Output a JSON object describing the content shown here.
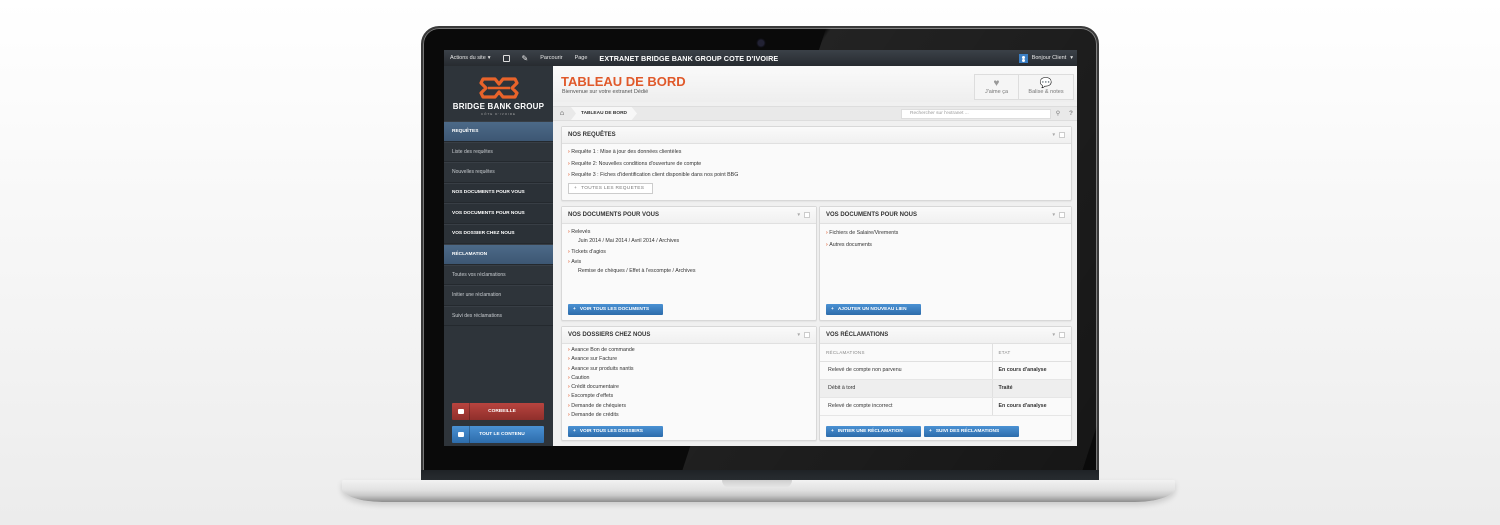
{
  "topbar": {
    "site_actions": "Actions du site",
    "browse": "Parcourir",
    "page": "Page",
    "title": "EXTRANET BRIDGE BANK GROUP COTE D'IVOIRE",
    "user": "Bonjour Client"
  },
  "logo": {
    "name": "BRIDGE BANK GROUP",
    "sub": "CÔTE D'IVOIRE",
    "brand_color": "#e8632a"
  },
  "sidebar": {
    "items": [
      {
        "label": "REQUÊTES",
        "type": "header"
      },
      {
        "label": "Liste des requêtes",
        "type": "sub"
      },
      {
        "label": "Nouvelles requêtes",
        "type": "sub"
      },
      {
        "label": "NOS DOCUMENTS POUR VOUS",
        "type": "section"
      },
      {
        "label": "VOS DOCUMENTS POUR NOUS",
        "type": "section"
      },
      {
        "label": "VOS DOSSIER CHEZ NOUS",
        "type": "section"
      },
      {
        "label": "RÉCLAMATION",
        "type": "header"
      },
      {
        "label": "Toutes vos réclamations",
        "type": "sub"
      },
      {
        "label": "Initier une réclamation",
        "type": "sub"
      },
      {
        "label": "Suivi des réclamations",
        "type": "sub"
      }
    ],
    "trash_button": "CORBEILLE",
    "all_content_button": "TOUT LE CONTENU"
  },
  "header": {
    "title": "TABLEAU DE BORD",
    "subtitle": "Bienvenue sur votre extranet Dédié",
    "like": "J'aime ça",
    "tags": "Balise & notes"
  },
  "breadcrumb": {
    "current": "TABLEAU DE BORD"
  },
  "search": {
    "placeholder": "Rechercher sur l'extranet ..."
  },
  "panels": {
    "requetes": {
      "title": "NOS REQUÊTES",
      "items": [
        "Requête 1 : Mise à jour des données clientèles",
        "Requête 2: Nouvelles conditions d'ouverture de compte",
        "Requête 3 : Fiches d'identification client disponible dans nos point BBG"
      ],
      "button": "TOUTES LES REQUETES"
    },
    "docs_vous": {
      "title": "NOS DOCUMENTS POUR VOUS",
      "releves": "Relevés",
      "releves_links": "Juin 2014   /   Mai 2014   / Avril 2014   /   Archives",
      "tickets": "Tickets d'agios",
      "avis": "Avis",
      "avis_links": "Remise de chèques   /   Effet à l'escompte   /   Archives",
      "button": "VOIR TOUS LES DOCUMENTS"
    },
    "docs_nous": {
      "title": "VOS DOCUMENTS POUR NOUS",
      "items": [
        "Fichiers de Salaire/Virements",
        "Autres documents"
      ],
      "button": "AJOUTER UN NOUVEAU LIEN"
    },
    "dossiers": {
      "title": "VOS DOSSIERS CHEZ NOUS",
      "items": [
        "Avance Bon de commande",
        "Avance sur Facture",
        "Avance sur produits nantis",
        "Caution",
        "Crédit documentaire",
        "Escompte d'effets",
        "Demande de chéquiers",
        "Demande de crédits"
      ],
      "button": "VOIR TOUS LES DOSSIERS"
    },
    "reclamations": {
      "title": "VOS RÉCLAMATIONS",
      "col_1": "RÉCLAMATIONS",
      "col_2": "ETAT",
      "rows": [
        {
          "label": "Relevé de compte non parvenu",
          "status": "En cours d'analyse",
          "color": "#e0592a"
        },
        {
          "label": "Débit à tord",
          "status": "Traité",
          "color": "#5aa83a"
        },
        {
          "label": "Relevé de compte incorrect",
          "status": "En cours d'analyse",
          "color": "#e0592a"
        }
      ],
      "button_initiate": "INITIER UNE RÉCLAMATION",
      "button_follow": "SUIVI DES RÉCLAMATIONS"
    }
  }
}
